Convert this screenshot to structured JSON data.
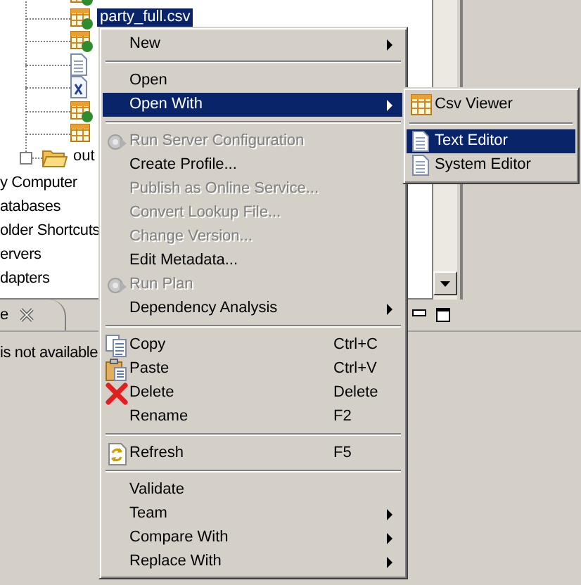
{
  "tree": {
    "rows": [
      {
        "kind": "csv-model"
      },
      {
        "kind": "csv-model",
        "label": "party_full.csv",
        "selected": true
      },
      {
        "kind": "csv-model"
      },
      {
        "kind": "document"
      },
      {
        "kind": "xml"
      },
      {
        "kind": "csv-model"
      },
      {
        "kind": "csv"
      },
      {
        "kind": "folder",
        "label": "out",
        "expandable": true,
        "selected": false
      }
    ],
    "cut_items": [
      "y Computer",
      "atabases",
      "older Shortcuts",
      "ervers",
      "dapters"
    ]
  },
  "bottom_panel": {
    "tab_label": "e",
    "message": "is not available"
  },
  "context_menu": {
    "items": [
      {
        "kind": "plain",
        "label": "New",
        "submenu": true,
        "disabled": false,
        "selected": false
      },
      {
        "kind": "separator"
      },
      {
        "kind": "plain",
        "label": "Open",
        "submenu": false,
        "disabled": false,
        "selected": false
      },
      {
        "kind": "plain",
        "label": "Open With",
        "submenu": true,
        "disabled": false,
        "selected": true
      },
      {
        "kind": "separator"
      },
      {
        "kind": "run",
        "label": "Run Server Configuration",
        "submenu": false,
        "disabled": true,
        "selected": false
      },
      {
        "kind": "plain",
        "label": "Create Profile...",
        "submenu": false,
        "disabled": false,
        "selected": false
      },
      {
        "kind": "plain",
        "label": "Publish as Online Service...",
        "submenu": false,
        "disabled": true,
        "selected": false
      },
      {
        "kind": "plain",
        "label": "Convert Lookup File...",
        "submenu": false,
        "disabled": true,
        "selected": false
      },
      {
        "kind": "plain",
        "label": "Change Version...",
        "submenu": false,
        "disabled": true,
        "selected": false
      },
      {
        "kind": "plain",
        "label": "Edit Metadata...",
        "submenu": false,
        "disabled": false,
        "selected": false
      },
      {
        "kind": "run",
        "label": "Run Plan",
        "submenu": false,
        "disabled": true,
        "selected": false
      },
      {
        "kind": "plain",
        "label": "Dependency Analysis",
        "submenu": true,
        "disabled": false,
        "selected": false
      },
      {
        "kind": "separator"
      },
      {
        "kind": "copy",
        "label": "Copy",
        "shortcut": "Ctrl+C",
        "submenu": false,
        "disabled": false,
        "selected": false
      },
      {
        "kind": "paste",
        "label": "Paste",
        "shortcut": "Ctrl+V",
        "submenu": false,
        "disabled": false,
        "selected": false
      },
      {
        "kind": "delete",
        "label": "Delete",
        "shortcut": "Delete",
        "submenu": false,
        "disabled": false,
        "selected": false
      },
      {
        "kind": "plain",
        "label": "Rename",
        "shortcut": "F2",
        "submenu": false,
        "disabled": false,
        "selected": false
      },
      {
        "kind": "separator"
      },
      {
        "kind": "refresh",
        "label": "Refresh",
        "shortcut": "F5",
        "submenu": false,
        "disabled": false,
        "selected": false
      },
      {
        "kind": "separator"
      },
      {
        "kind": "plain",
        "label": "Validate",
        "submenu": false,
        "disabled": false,
        "selected": false
      },
      {
        "kind": "plain",
        "label": "Team",
        "submenu": true,
        "disabled": false,
        "selected": false
      },
      {
        "kind": "plain",
        "label": "Compare With",
        "submenu": true,
        "disabled": false,
        "selected": false
      },
      {
        "kind": "plain",
        "label": "Replace With",
        "submenu": true,
        "disabled": false,
        "selected": false
      }
    ]
  },
  "submenu": {
    "items": [
      {
        "kind": "csv",
        "label": "Csv Viewer",
        "selected": false
      },
      {
        "kind": "separator"
      },
      {
        "kind": "document",
        "label": "Text Editor",
        "selected": true
      },
      {
        "kind": "document",
        "label": "System Editor",
        "selected": false
      }
    ]
  }
}
